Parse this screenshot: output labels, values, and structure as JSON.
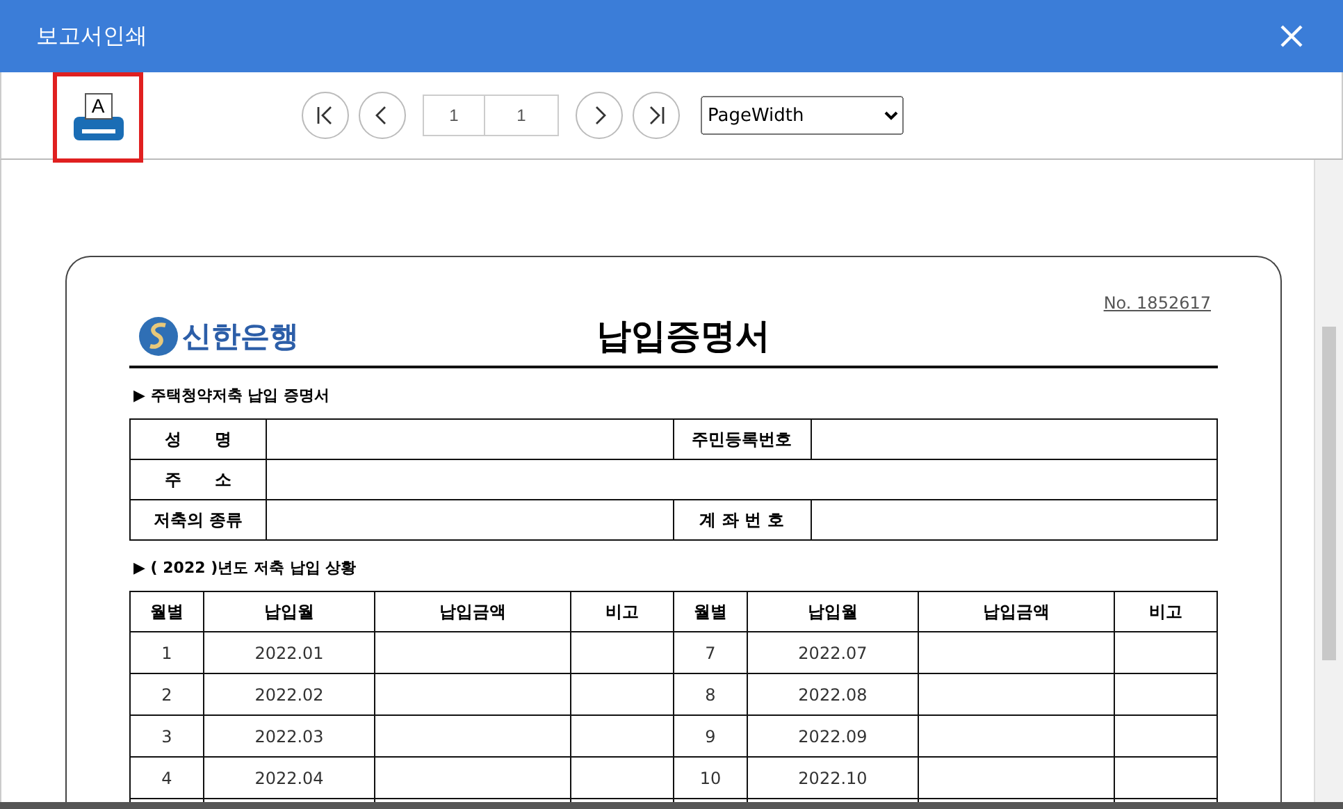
{
  "window": {
    "title": "보고서인쇄"
  },
  "toolbar": {
    "print_button": {
      "focused": true,
      "icon_letter": "A"
    },
    "page_fields": [
      "1",
      "1"
    ],
    "zoom_select": {
      "value": "PageWidth"
    }
  },
  "document": {
    "number": "No. 1852617",
    "bank_name": "신한은행",
    "title": "납입증명서",
    "section_1": "▶ 주택청약저축 납입 증명서",
    "info_rows": [
      {
        "label": "성　　명",
        "label_2": "주민등록번호"
      },
      {
        "label": "주　　소"
      },
      {
        "label": "저축의 종류",
        "label_2": "계 좌 번 호"
      }
    ],
    "section_2": "▶ ( 2022 )년도 저축 납입 상황",
    "columns": [
      "월별",
      "납입월",
      "납입금액",
      "비고",
      "월별",
      "납입월",
      "납입금액",
      "비고"
    ],
    "rows": [
      [
        "1",
        "2022.01",
        "7",
        "2022.07"
      ],
      [
        "2",
        "2022.02",
        "8",
        "2022.08"
      ],
      [
        "3",
        "2022.03",
        "9",
        "2022.09"
      ],
      [
        "4",
        "2022.04",
        "10",
        "2022.10"
      ]
    ]
  }
}
